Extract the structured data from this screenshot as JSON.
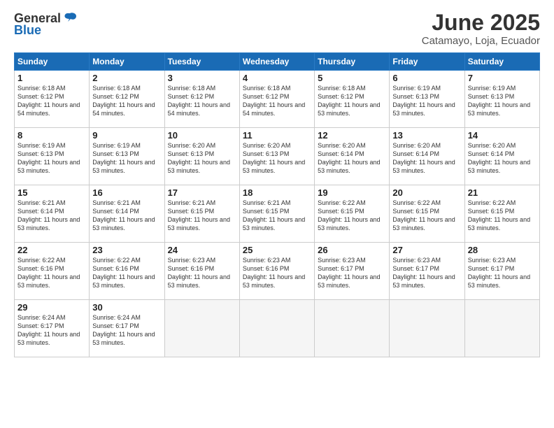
{
  "header": {
    "logo_general": "General",
    "logo_blue": "Blue",
    "month": "June 2025",
    "location": "Catamayo, Loja, Ecuador"
  },
  "days_of_week": [
    "Sunday",
    "Monday",
    "Tuesday",
    "Wednesday",
    "Thursday",
    "Friday",
    "Saturday"
  ],
  "weeks": [
    [
      {
        "day": "1",
        "sunrise": "6:18 AM",
        "sunset": "6:12 PM",
        "daylight": "11 hours and 54 minutes."
      },
      {
        "day": "2",
        "sunrise": "6:18 AM",
        "sunset": "6:12 PM",
        "daylight": "11 hours and 54 minutes."
      },
      {
        "day": "3",
        "sunrise": "6:18 AM",
        "sunset": "6:12 PM",
        "daylight": "11 hours and 54 minutes."
      },
      {
        "day": "4",
        "sunrise": "6:18 AM",
        "sunset": "6:12 PM",
        "daylight": "11 hours and 54 minutes."
      },
      {
        "day": "5",
        "sunrise": "6:18 AM",
        "sunset": "6:12 PM",
        "daylight": "11 hours and 53 minutes."
      },
      {
        "day": "6",
        "sunrise": "6:19 AM",
        "sunset": "6:13 PM",
        "daylight": "11 hours and 53 minutes."
      },
      {
        "day": "7",
        "sunrise": "6:19 AM",
        "sunset": "6:13 PM",
        "daylight": "11 hours and 53 minutes."
      }
    ],
    [
      {
        "day": "8",
        "sunrise": "6:19 AM",
        "sunset": "6:13 PM",
        "daylight": "11 hours and 53 minutes."
      },
      {
        "day": "9",
        "sunrise": "6:19 AM",
        "sunset": "6:13 PM",
        "daylight": "11 hours and 53 minutes."
      },
      {
        "day": "10",
        "sunrise": "6:20 AM",
        "sunset": "6:13 PM",
        "daylight": "11 hours and 53 minutes."
      },
      {
        "day": "11",
        "sunrise": "6:20 AM",
        "sunset": "6:13 PM",
        "daylight": "11 hours and 53 minutes."
      },
      {
        "day": "12",
        "sunrise": "6:20 AM",
        "sunset": "6:14 PM",
        "daylight": "11 hours and 53 minutes."
      },
      {
        "day": "13",
        "sunrise": "6:20 AM",
        "sunset": "6:14 PM",
        "daylight": "11 hours and 53 minutes."
      },
      {
        "day": "14",
        "sunrise": "6:20 AM",
        "sunset": "6:14 PM",
        "daylight": "11 hours and 53 minutes."
      }
    ],
    [
      {
        "day": "15",
        "sunrise": "6:21 AM",
        "sunset": "6:14 PM",
        "daylight": "11 hours and 53 minutes."
      },
      {
        "day": "16",
        "sunrise": "6:21 AM",
        "sunset": "6:14 PM",
        "daylight": "11 hours and 53 minutes."
      },
      {
        "day": "17",
        "sunrise": "6:21 AM",
        "sunset": "6:15 PM",
        "daylight": "11 hours and 53 minutes."
      },
      {
        "day": "18",
        "sunrise": "6:21 AM",
        "sunset": "6:15 PM",
        "daylight": "11 hours and 53 minutes."
      },
      {
        "day": "19",
        "sunrise": "6:22 AM",
        "sunset": "6:15 PM",
        "daylight": "11 hours and 53 minutes."
      },
      {
        "day": "20",
        "sunrise": "6:22 AM",
        "sunset": "6:15 PM",
        "daylight": "11 hours and 53 minutes."
      },
      {
        "day": "21",
        "sunrise": "6:22 AM",
        "sunset": "6:15 PM",
        "daylight": "11 hours and 53 minutes."
      }
    ],
    [
      {
        "day": "22",
        "sunrise": "6:22 AM",
        "sunset": "6:16 PM",
        "daylight": "11 hours and 53 minutes."
      },
      {
        "day": "23",
        "sunrise": "6:22 AM",
        "sunset": "6:16 PM",
        "daylight": "11 hours and 53 minutes."
      },
      {
        "day": "24",
        "sunrise": "6:23 AM",
        "sunset": "6:16 PM",
        "daylight": "11 hours and 53 minutes."
      },
      {
        "day": "25",
        "sunrise": "6:23 AM",
        "sunset": "6:16 PM",
        "daylight": "11 hours and 53 minutes."
      },
      {
        "day": "26",
        "sunrise": "6:23 AM",
        "sunset": "6:17 PM",
        "daylight": "11 hours and 53 minutes."
      },
      {
        "day": "27",
        "sunrise": "6:23 AM",
        "sunset": "6:17 PM",
        "daylight": "11 hours and 53 minutes."
      },
      {
        "day": "28",
        "sunrise": "6:23 AM",
        "sunset": "6:17 PM",
        "daylight": "11 hours and 53 minutes."
      }
    ],
    [
      {
        "day": "29",
        "sunrise": "6:24 AM",
        "sunset": "6:17 PM",
        "daylight": "11 hours and 53 minutes."
      },
      {
        "day": "30",
        "sunrise": "6:24 AM",
        "sunset": "6:17 PM",
        "daylight": "11 hours and 53 minutes."
      },
      null,
      null,
      null,
      null,
      null
    ]
  ]
}
